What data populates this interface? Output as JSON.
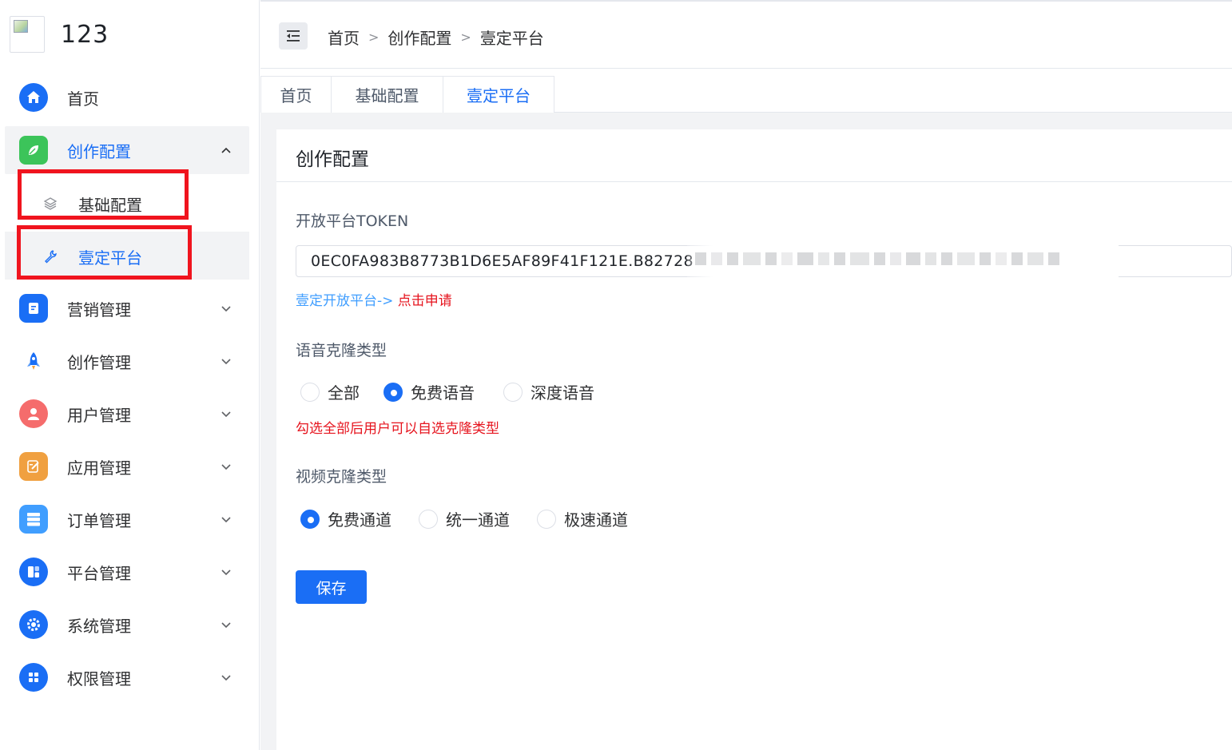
{
  "app": {
    "title": "123"
  },
  "sidebar": {
    "items": [
      {
        "label": "首页",
        "icon": "home-icon",
        "color": "#1a6ef5"
      },
      {
        "label": "创作配置",
        "icon": "leaf-icon",
        "color": "#3cc45a"
      },
      {
        "label": "营销管理",
        "icon": "document-icon",
        "color": "#1a6ef5"
      },
      {
        "label": "创作管理",
        "icon": "rocket-icon",
        "color": "#1a6ef5"
      },
      {
        "label": "用户管理",
        "icon": "user-icon",
        "color": "#f56c6c"
      },
      {
        "label": "应用管理",
        "icon": "edit-icon",
        "color": "#f0a040"
      },
      {
        "label": "订单管理",
        "icon": "server-icon",
        "color": "#409eff"
      },
      {
        "label": "平台管理",
        "icon": "layout-icon",
        "color": "#1a6ef5"
      },
      {
        "label": "系统管理",
        "icon": "gear-icon",
        "color": "#1a6ef5"
      },
      {
        "label": "权限管理",
        "icon": "grid-icon",
        "color": "#1a6ef5"
      }
    ],
    "sub_items": [
      {
        "label": "基础配置",
        "icon": "layers-icon"
      },
      {
        "label": "壹定平台",
        "icon": "wrench-icon"
      }
    ]
  },
  "breadcrumb": [
    "首页",
    "创作配置",
    "壹定平台"
  ],
  "tabs": [
    "首页",
    "基础配置",
    "壹定平台"
  ],
  "card": {
    "title": "创作配置",
    "token_label": "开放平台TOKEN",
    "token_value": "0EC0FA983B8773B1D6E5AF89F41F121E.B82728",
    "link_prefix": "壹定开放平台-> ",
    "link_action": "点击申请",
    "voice_label": "语音克隆类型",
    "voice_options": [
      "全部",
      "免费语音",
      "深度语音"
    ],
    "voice_selected": "免费语音",
    "voice_hint": "勾选全部后用户可以自选克隆类型",
    "video_label": "视频克隆类型",
    "video_options": [
      "免费通道",
      "统一通道",
      "极速通道"
    ],
    "video_selected": "免费通道",
    "save_label": "保存"
  }
}
